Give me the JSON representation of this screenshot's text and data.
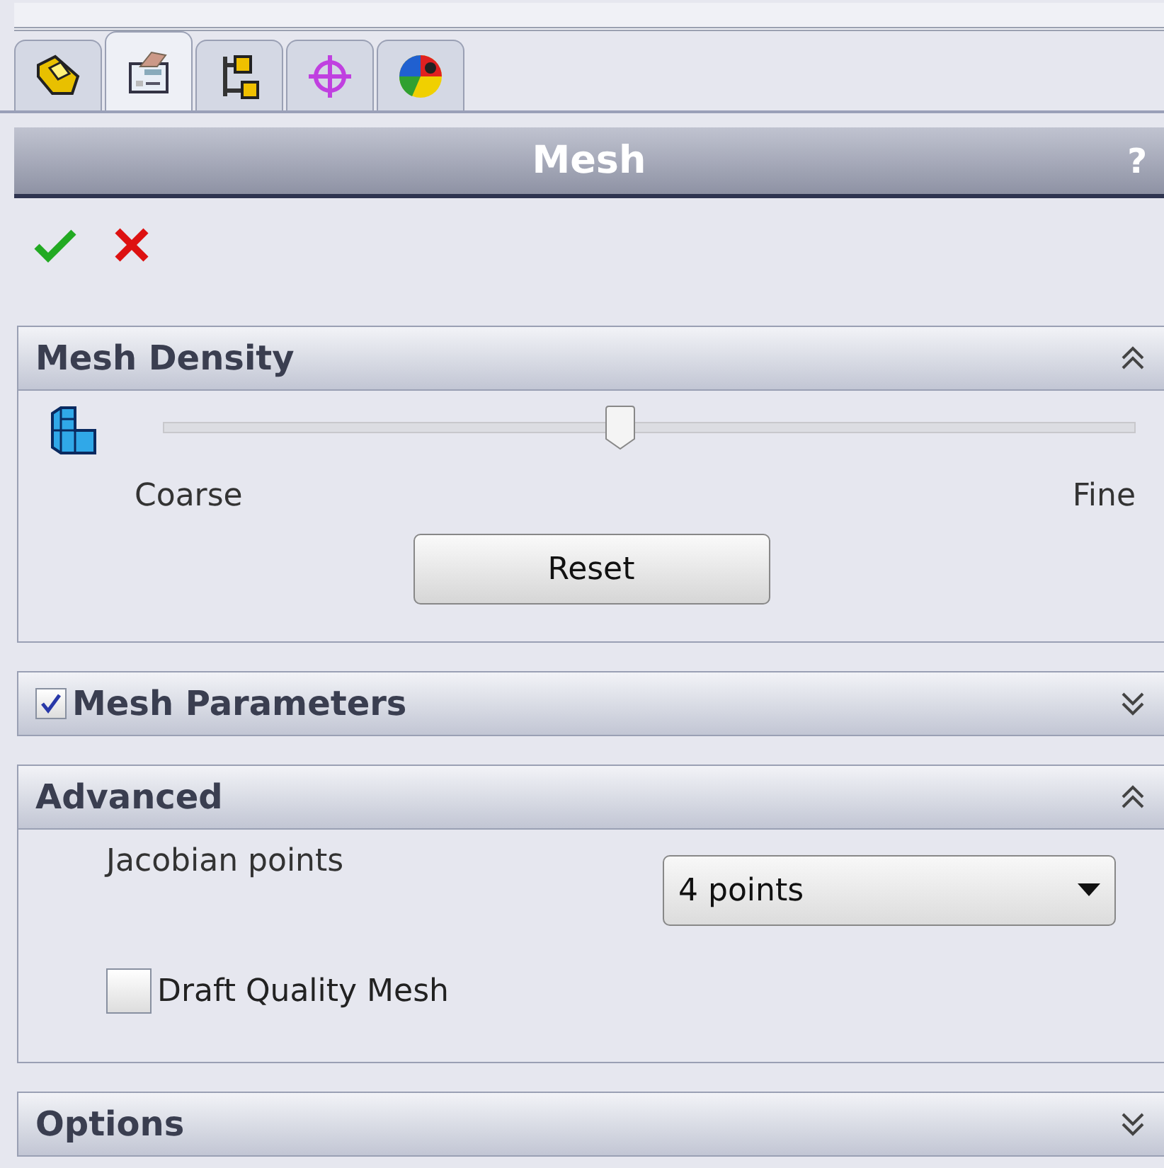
{
  "tabs": [
    {
      "selected": false
    },
    {
      "selected": true
    },
    {
      "selected": false
    },
    {
      "selected": false
    },
    {
      "selected": false
    }
  ],
  "title_bar": {
    "title": "Mesh",
    "help": "?"
  },
  "sections": [
    {
      "kind": "density",
      "title": "Mesh Density",
      "expanded": true,
      "slider": {
        "level": 0.47,
        "min_label": "Coarse",
        "max_label": "Fine"
      },
      "button": "Reset"
    },
    {
      "kind": "checkable",
      "title": "Mesh Parameters",
      "expanded": false,
      "checked": true
    },
    {
      "kind": "advanced",
      "title": "Advanced",
      "expanded": true,
      "field_label": "Jacobian points",
      "dropdown": {
        "value": "4 points"
      },
      "checkbox": {
        "label": "Draft Quality Mesh",
        "checked": false
      }
    },
    {
      "kind": "plain",
      "title": "Options",
      "expanded": false
    }
  ]
}
